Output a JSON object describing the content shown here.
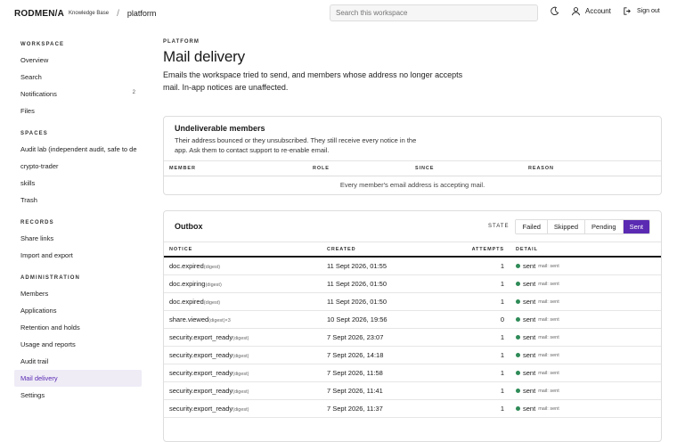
{
  "header": {
    "logo": "RODMEN/A",
    "logo_sub": "Knowledge Base",
    "crumb": "platform",
    "search_placeholder": "Search this workspace",
    "account": "Account",
    "signout": "Sign out"
  },
  "sidebar": {
    "sections": [
      {
        "title": "WORKSPACE",
        "items": [
          {
            "label": "Overview"
          },
          {
            "label": "Search"
          },
          {
            "label": "Notifications",
            "count": "2"
          },
          {
            "label": "Files"
          }
        ]
      },
      {
        "title": "SPACES",
        "items": [
          {
            "label": "Audit lab (independent audit, safe to de"
          },
          {
            "label": "crypto-trader"
          },
          {
            "label": "skills"
          },
          {
            "label": "Trash"
          }
        ]
      },
      {
        "title": "RECORDS",
        "items": [
          {
            "label": "Share links"
          },
          {
            "label": "Import and export"
          }
        ]
      },
      {
        "title": "ADMINISTRATION",
        "items": [
          {
            "label": "Members"
          },
          {
            "label": "Applications"
          },
          {
            "label": "Retention and holds"
          },
          {
            "label": "Usage and reports"
          },
          {
            "label": "Audit trail"
          },
          {
            "label": "Mail delivery",
            "active": true
          },
          {
            "label": "Settings"
          }
        ]
      }
    ]
  },
  "page": {
    "eyebrow": "PLATFORM",
    "title": "Mail delivery",
    "description": "Emails the workspace tried to send, and members whose address no longer accepts mail. In-app notices are unaffected."
  },
  "undeliverable": {
    "title": "Undeliverable members",
    "description": "Their address bounced or they unsubscribed. They still receive every notice in the app. Ask them to contact support to re-enable email.",
    "columns": [
      "MEMBER",
      "ROLE",
      "SINCE",
      "REASON"
    ],
    "empty": "Every member's email address is accepting mail."
  },
  "outbox": {
    "title": "Outbox",
    "state_label": "STATE",
    "filters": [
      {
        "label": "Failed"
      },
      {
        "label": "Skipped"
      },
      {
        "label": "Pending"
      },
      {
        "label": "Sent",
        "active": true
      }
    ],
    "columns": [
      "NOTICE",
      "CREATED",
      "ATTEMPTS",
      "DETAIL"
    ],
    "rows": [
      {
        "notice": "doc.expired",
        "sub": "(digest)",
        "created": "11 Sept 2026, 01:55",
        "attempts": "1",
        "status": "sent",
        "detail": "mail: sent"
      },
      {
        "notice": "doc.expiring",
        "sub": "(digest)",
        "created": "11 Sept 2026, 01:50",
        "attempts": "1",
        "status": "sent",
        "detail": "mail: sent"
      },
      {
        "notice": "doc.expired",
        "sub": "(digest)",
        "created": "11 Sept 2026, 01:50",
        "attempts": "1",
        "status": "sent",
        "detail": "mail: sent"
      },
      {
        "notice": "share.viewed",
        "sub": "(digest)×3",
        "created": "10 Sept 2026, 19:56",
        "attempts": "0",
        "status": "sent",
        "detail": "mail: sent"
      },
      {
        "notice": "security.export_ready",
        "sub": "(digest)",
        "created": "7 Sept 2026, 23:07",
        "attempts": "1",
        "status": "sent",
        "detail": "mail: sent"
      },
      {
        "notice": "security.export_ready",
        "sub": "(digest)",
        "created": "7 Sept 2026, 14:18",
        "attempts": "1",
        "status": "sent",
        "detail": "mail: sent"
      },
      {
        "notice": "security.export_ready",
        "sub": "(digest)",
        "created": "7 Sept 2026, 11:58",
        "attempts": "1",
        "status": "sent",
        "detail": "mail: sent"
      },
      {
        "notice": "security.export_ready",
        "sub": "(digest)",
        "created": "7 Sept 2026, 11:41",
        "attempts": "1",
        "status": "sent",
        "detail": "mail: sent"
      },
      {
        "notice": "security.export_ready",
        "sub": "(digest)",
        "created": "7 Sept 2026, 11:37",
        "attempts": "1",
        "status": "sent",
        "detail": "mail: sent"
      }
    ]
  },
  "colors": {
    "accent": "#5a2ab3",
    "sent": "#2e8b57"
  }
}
